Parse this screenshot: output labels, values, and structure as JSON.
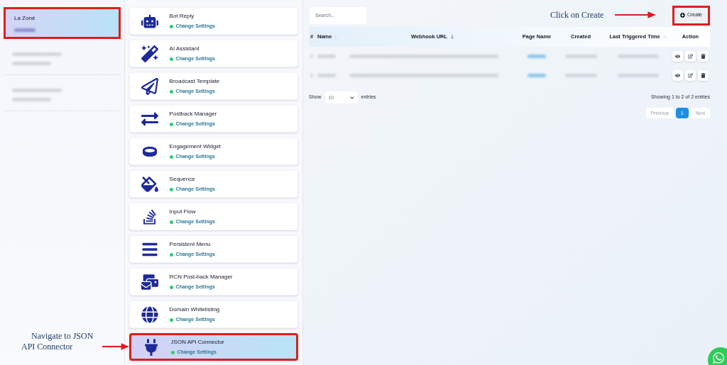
{
  "pages": [
    {
      "name": "La Zoné",
      "selected": true,
      "highlighted": true
    },
    {
      "selected": false,
      "highlighted": false
    },
    {
      "selected": false,
      "highlighted": false
    }
  ],
  "features": [
    {
      "title": "Bot Reply",
      "status": "Change Settings",
      "selected": false,
      "highlighted": false
    },
    {
      "title": "AI Assistant",
      "status": "Change Settings",
      "selected": false,
      "highlighted": false
    },
    {
      "title": "Broadcast Template",
      "status": "Change Settings",
      "selected": false,
      "highlighted": false
    },
    {
      "title": "Postback Manager",
      "status": "Change Settings",
      "selected": false,
      "highlighted": false
    },
    {
      "title": "Engagement Widget",
      "status": "Change Settings",
      "selected": false,
      "highlighted": false
    },
    {
      "title": "Sequence",
      "status": "Change Settings",
      "selected": false,
      "highlighted": false
    },
    {
      "title": "Input Flow",
      "status": "Change Settings",
      "selected": false,
      "highlighted": false
    },
    {
      "title": "Persistent Menu",
      "status": "Change Settings",
      "selected": false,
      "highlighted": false
    },
    {
      "title": "RCN Post-back Manager",
      "status": "Change Settings",
      "selected": false,
      "highlighted": false
    },
    {
      "title": "Domain Whitelisting",
      "status": "Change Settings",
      "selected": false,
      "highlighted": false
    },
    {
      "title": "JSON API Connector",
      "status": "Change Settings",
      "selected": true,
      "highlighted": true
    }
  ],
  "search": {
    "placeholder": "Search..."
  },
  "create_button": {
    "label": "Create",
    "highlighted": true
  },
  "table": {
    "columns": [
      {
        "label": "#"
      },
      {
        "label": "Name",
        "sorted": false
      },
      {
        "label": "Webhook URL",
        "sorted": true
      },
      {
        "label": "Page Name"
      },
      {
        "label": "Created"
      },
      {
        "label": "Last Triggered Time",
        "sorted": false
      },
      {
        "label": "Action"
      }
    ],
    "rows": [
      {
        "kind": "redacted"
      },
      {
        "kind": "redacted"
      }
    ]
  },
  "length_menu": {
    "prefix": "Show",
    "value": "10",
    "suffix": "entries"
  },
  "info": "Showing 1 to 2 of 2 entries",
  "pagination": [
    {
      "label": "Previous",
      "selected": false
    },
    {
      "label": "1",
      "selected": true
    },
    {
      "label": "Next",
      "selected": false
    }
  ],
  "annotations": [
    {
      "kind": "create",
      "text": "Click on Create"
    },
    {
      "kind": "navigate",
      "text": "Navigate to JSON API Connector"
    }
  ]
}
